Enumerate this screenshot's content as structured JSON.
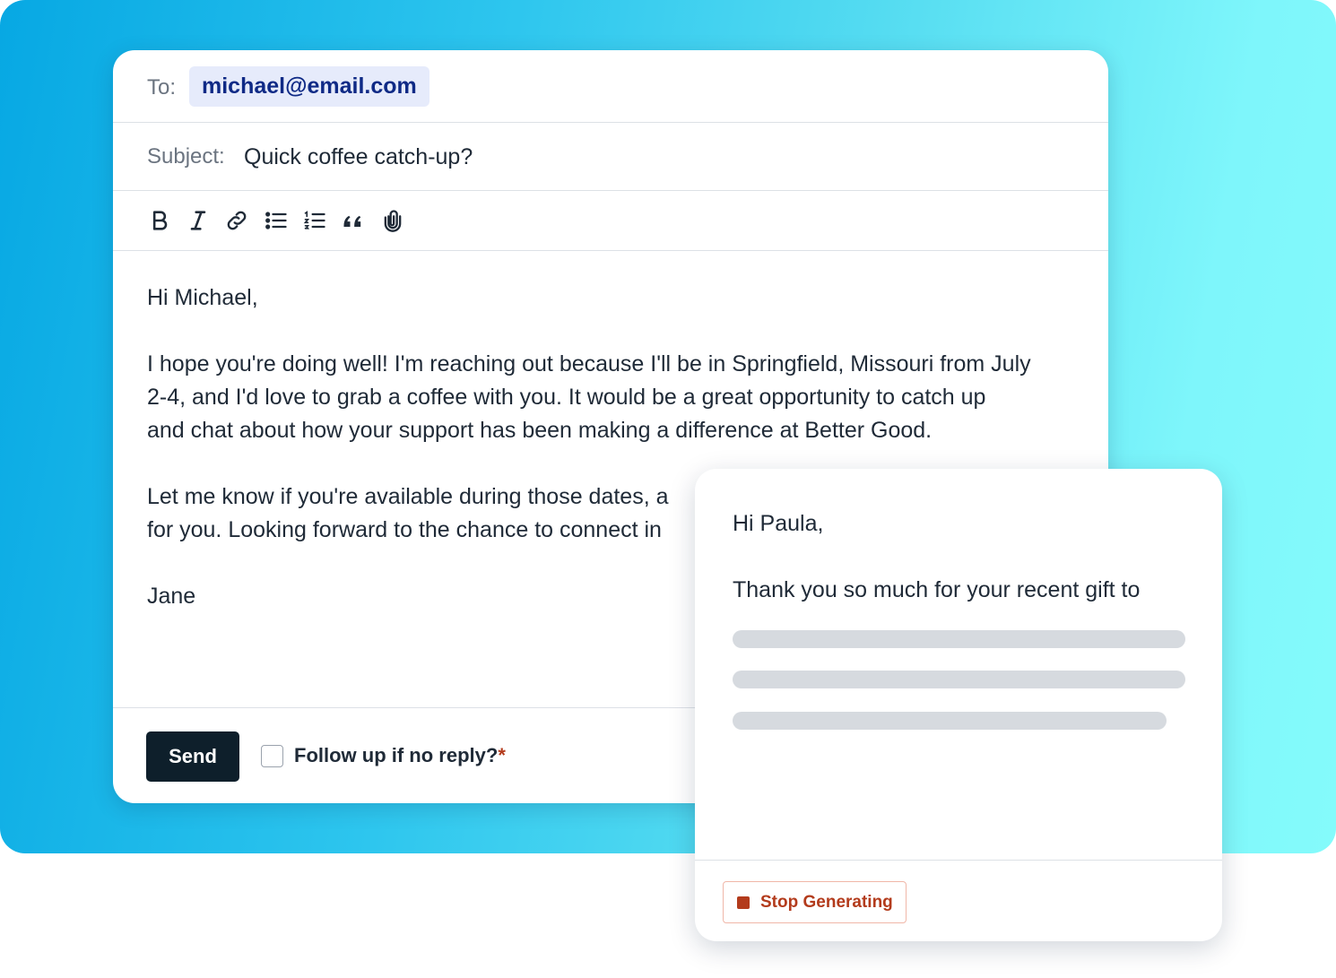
{
  "composer": {
    "to_label": "To:",
    "to_value": "michael@email.com",
    "subject_label": "Subject:",
    "subject_value": "Quick coffee catch-up?",
    "toolbar": [
      "bold-icon",
      "italic-icon",
      "link-icon",
      "bullet-list-icon",
      "numbered-list-icon",
      "quote-icon",
      "attachment-icon"
    ],
    "body": {
      "greeting": "Hi Michael,",
      "para1_line1": "I hope you're doing well! I'm reaching out because I'll be in Springfield, Missouri from July",
      "para1_line2": "2-4, and I'd love to grab a coffee with you. It would be a great opportunity to catch up",
      "para1_line3": "and chat about how your support has been making a difference at Better Good.",
      "para2_line1": "Let me know if you're available during those dates, a",
      "para2_line2": "for you. Looking forward to the chance to connect in",
      "signoff": "Jane"
    },
    "send_label": "Send",
    "followup_label": "Follow up if no reply?",
    "required_mark": "*"
  },
  "ai_draft": {
    "greeting": "Hi Paula,",
    "line1": "Thank you so much for your recent gift to",
    "stop_label": "Stop Generating"
  },
  "colors": {
    "gradient_start": "#07a8e3",
    "gradient_end": "#84fbfb",
    "send_button": "#0e1f2b",
    "email_chip_bg": "#e6ebfb",
    "email_chip_text": "#0f2a86",
    "stop_accent": "#b33b1c"
  }
}
